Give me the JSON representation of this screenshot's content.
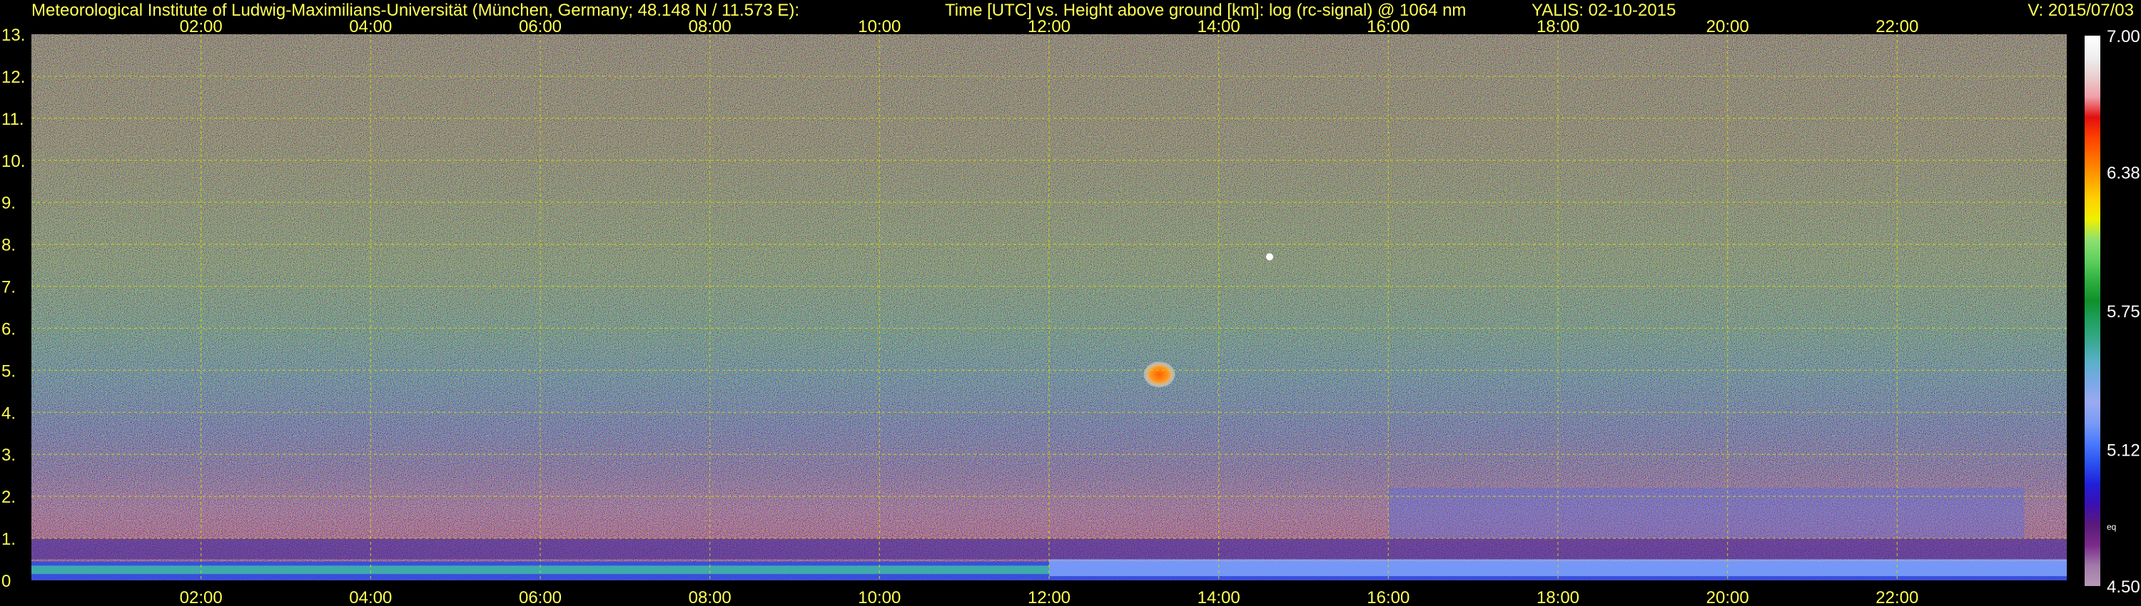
{
  "header": {
    "institute": "Meteorological Institute of Ludwig-Maximilians-Universität (München, Germany; 48.148 N / 11.573 E):",
    "description": "Time [UTC] vs. Height above ground [km]: log (rc-signal) @ 1064 nm",
    "station": "YALIS: 02-10-2015",
    "version": "V: 2015/07/03"
  },
  "chart_data": {
    "type": "heatmap",
    "title": "Time [UTC] vs. Height above ground [km]: log (rc-signal) @ 1064 nm",
    "x_range_hours": [
      0,
      24
    ],
    "x_ticks": [
      "02:00",
      "04:00",
      "06:00",
      "08:00",
      "10:00",
      "12:00",
      "14:00",
      "16:00",
      "18:00",
      "20:00",
      "22:00"
    ],
    "x_tick_hours": [
      2,
      4,
      6,
      8,
      10,
      12,
      14,
      16,
      18,
      20,
      22
    ],
    "ylim": [
      0,
      13
    ],
    "y_ticks": [
      "0",
      "1.",
      "2.",
      "3.",
      "4.",
      "5.",
      "6.",
      "7.",
      "8.",
      "9.",
      "10.",
      "11.",
      "12.",
      "13."
    ],
    "y_tick_values": [
      0,
      1,
      2,
      3,
      4,
      5,
      6,
      7,
      8,
      9,
      10,
      11,
      12,
      13
    ],
    "grid": true,
    "colorbar": {
      "ticks": [
        "7.00",
        "6.38",
        "5.75",
        "5.12",
        "4.50"
      ],
      "tick_values": [
        7.0,
        6.38,
        5.75,
        5.12,
        4.5
      ],
      "min": 4.5,
      "max": 7.0,
      "note": "eq",
      "colors": [
        "#b898b8",
        "#a07aa8",
        "#7a2a8a",
        "#5a1a7a",
        "#3a10b0",
        "#2020d8",
        "#2a50ee",
        "#4a7aff",
        "#7a9af5",
        "#9aaaf0",
        "#7aa8e8",
        "#5ab0c8",
        "#3aa890",
        "#20a060",
        "#10902a",
        "#30b040",
        "#60d060",
        "#90e070",
        "#f0f000",
        "#ffd000",
        "#ffa000",
        "#ff7000",
        "#ff4000",
        "#e01010",
        "#f0a0a8",
        "#e8d0d0",
        "#f0f0f0",
        "#ffffff"
      ]
    },
    "features": [
      {
        "kind": "cloud",
        "time_h": 13.3,
        "height_km": 4.9,
        "color": "#ff8a20"
      },
      {
        "kind": "spot",
        "time_h": 14.6,
        "height_km": 7.7,
        "color": "#ffffff"
      }
    ]
  },
  "colors": {
    "axis_text": "#ffff55",
    "grid": "#d8d800",
    "background": "#000000"
  }
}
